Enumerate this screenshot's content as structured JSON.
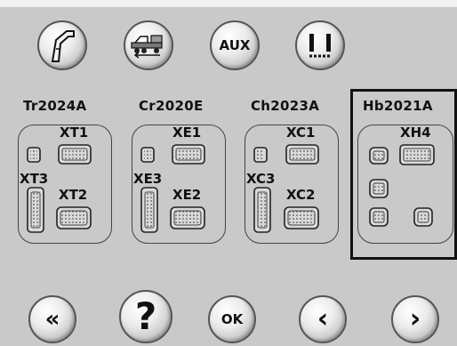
{
  "top_buttons": [
    {
      "icon": "boom-icon"
    },
    {
      "icon": "truck-icon"
    },
    {
      "label": "AUX"
    },
    {
      "icon": "level-icon"
    }
  ],
  "units": [
    {
      "name": "Tr2024A",
      "connectors": [
        "XT1",
        "XT3",
        "XT2"
      ]
    },
    {
      "name": "Cr2020E",
      "connectors": [
        "XE1",
        "XE3",
        "XE2"
      ]
    },
    {
      "name": "Ch2023A",
      "connectors": [
        "XC1",
        "XC3",
        "XC2"
      ]
    },
    {
      "name": "Hb2021A",
      "connectors": [
        "XH4"
      ],
      "selected": true
    }
  ],
  "bottom_buttons": [
    {
      "label": "«",
      "icon": "double-chevron-left-icon"
    },
    {
      "label": "?",
      "icon": "help-icon"
    },
    {
      "label": "OK"
    },
    {
      "label": "‹",
      "icon": "chevron-left-icon"
    },
    {
      "label": "›",
      "icon": "chevron-right-icon"
    }
  ],
  "colors": {
    "background": "#c9c9c9",
    "connector_fill": "#d9d9d9",
    "outline": "#444444"
  }
}
